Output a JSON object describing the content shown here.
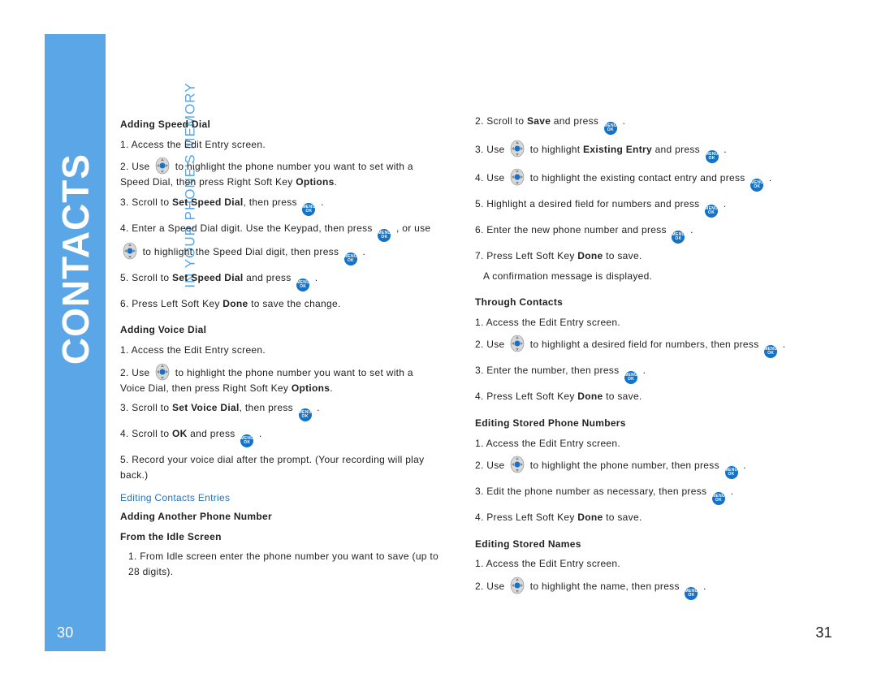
{
  "band": {
    "big": "CONTACTS",
    "small": "IN YOUR PHONE'S MEMORY"
  },
  "pages": {
    "left": "30",
    "right": "31"
  },
  "left": {
    "h1": "Adding Speed Dial",
    "s1": "1. Access the Edit Entry screen.",
    "s2a": "2. Use ",
    "s2b": " to highlight the phone number you want to set with a Speed Dial, then press Right Soft Key ",
    "s2c": "Options",
    "s2d": ".",
    "s3a": "3. Scroll to ",
    "s3b": "Set Speed Dial",
    "s3c": ", then press ",
    "s3d": " .",
    "s4a": "4. Enter a Speed Dial digit. Use the Keypad, then press ",
    "s4b": " , or use ",
    "s4c": " to highlight the Speed Dial digit, then press ",
    "s4d": " .",
    "s5a": "5. Scroll to ",
    "s5b": "Set Speed Dial",
    "s5c": " and press ",
    "s5d": " .",
    "s6a": "6. Press Left Soft Key ",
    "s6b": "Done",
    "s6c": " to save the change.",
    "h2": "Adding Voice Dial",
    "v1": "1. Access the Edit Entry screen.",
    "v2a": "2. Use ",
    "v2b": " to highlight the phone number you want to set with a Voice Dial, then press Right Soft Key ",
    "v2c": "Options",
    "v2d": ".",
    "v3a": "3. Scroll to ",
    "v3b": "Set Voice Dial",
    "v3c": ", then press ",
    "v3d": " .",
    "v4a": "4. Scroll to ",
    "v4b": "OK",
    "v4c": " and press ",
    "v4d": " .",
    "v5": "5. Record your voice dial after the prompt. (Your recording will play back.)",
    "sec": "Editing Contacts Entries",
    "h3": "Adding Another Phone Number",
    "h4": "From the Idle Screen",
    "i1": "1. From Idle screen enter the phone number you want to save (up to 28 digits)."
  },
  "right": {
    "r2a": "2. Scroll to ",
    "r2b": "Save",
    "r2c": " and press ",
    "r2d": " .",
    "r3a": "3. Use ",
    "r3b": " to highlight ",
    "r3c": "Existing Entry",
    "r3d": " and press ",
    "r3e": " .",
    "r4a": "4. Use ",
    "r4b": " to highlight the existing contact entry and press ",
    "r4c": " .",
    "r5a": "5. Highlight a desired field for numbers and press ",
    "r5b": " .",
    "r6a": "6. Enter the new phone number and press ",
    "r6b": " .",
    "r7a": "7. Press Left Soft Key ",
    "r7b": "Done",
    "r7c": " to save.",
    "r8": "A confirmation message is displayed.",
    "h5": "Through Contacts",
    "t1": "1. Access the Edit Entry screen.",
    "t2a": "2. Use ",
    "t2b": " to highlight a desired field for numbers, then press ",
    "t2c": " .",
    "t3a": "3. Enter the number, then press ",
    "t3b": " .",
    "t4a": "4. Press Left Soft Key ",
    "t4b": "Done",
    "t4c": " to save.",
    "h6": "Editing Stored Phone Numbers",
    "e1": "1. Access the Edit Entry screen.",
    "e2a": "2. Use ",
    "e2b": " to highlight the phone number, then press ",
    "e2c": " .",
    "e3a": "3. Edit the phone number as necessary, then press ",
    "e3b": " .",
    "e4a": "4. Press Left Soft Key ",
    "e4b": "Done",
    "e4c": " to save.",
    "h7": "Editing Stored Names",
    "n1": "1. Access the Edit Entry screen.",
    "n2a": "2. Use ",
    "n2b": " to highlight the name, then press ",
    "n2c": " ."
  }
}
